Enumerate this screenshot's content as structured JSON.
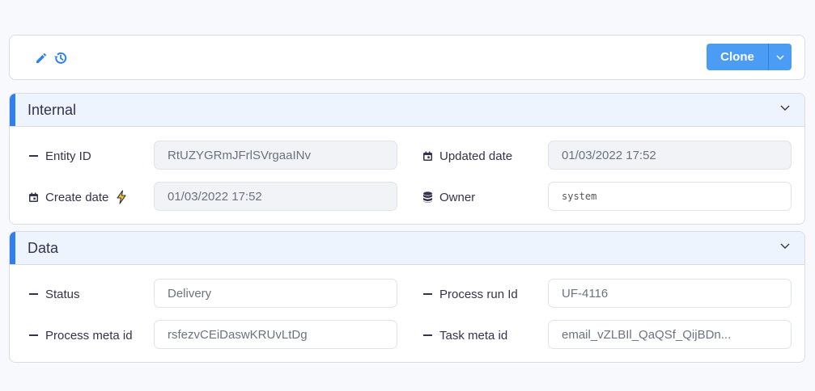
{
  "toolbar": {
    "edit_icon": "pencil-icon",
    "history_icon": "history-icon",
    "clone_label": "Clone",
    "clone_dropdown_icon": "chevron-down-icon"
  },
  "colors": {
    "accent": "#2f80ed",
    "button": "#4b9cf4",
    "section_header_bg": "#eef4fd"
  },
  "internal": {
    "title": "Internal",
    "fields": {
      "entity_id": {
        "label": "Entity ID",
        "value": "RtUZYGRmJFrlSVrgaaINv"
      },
      "updated_date": {
        "label": "Updated date",
        "value": "01/03/2022 17:52"
      },
      "create_date": {
        "label": "Create date",
        "value": "01/03/2022 17:52"
      },
      "owner": {
        "label": "Owner",
        "value": "system"
      }
    }
  },
  "data": {
    "title": "Data",
    "fields": {
      "status": {
        "label": "Status",
        "value": "Delivery"
      },
      "process_run_id": {
        "label": "Process run Id",
        "value": "UF-4116"
      },
      "process_meta_id": {
        "label": "Process meta id",
        "value": "rsfezvCEiDaswKRUvLtDg"
      },
      "task_meta_id": {
        "label": "Task meta id",
        "value": "email_vZLBIl_QaQSf_QijBDn..."
      }
    }
  }
}
